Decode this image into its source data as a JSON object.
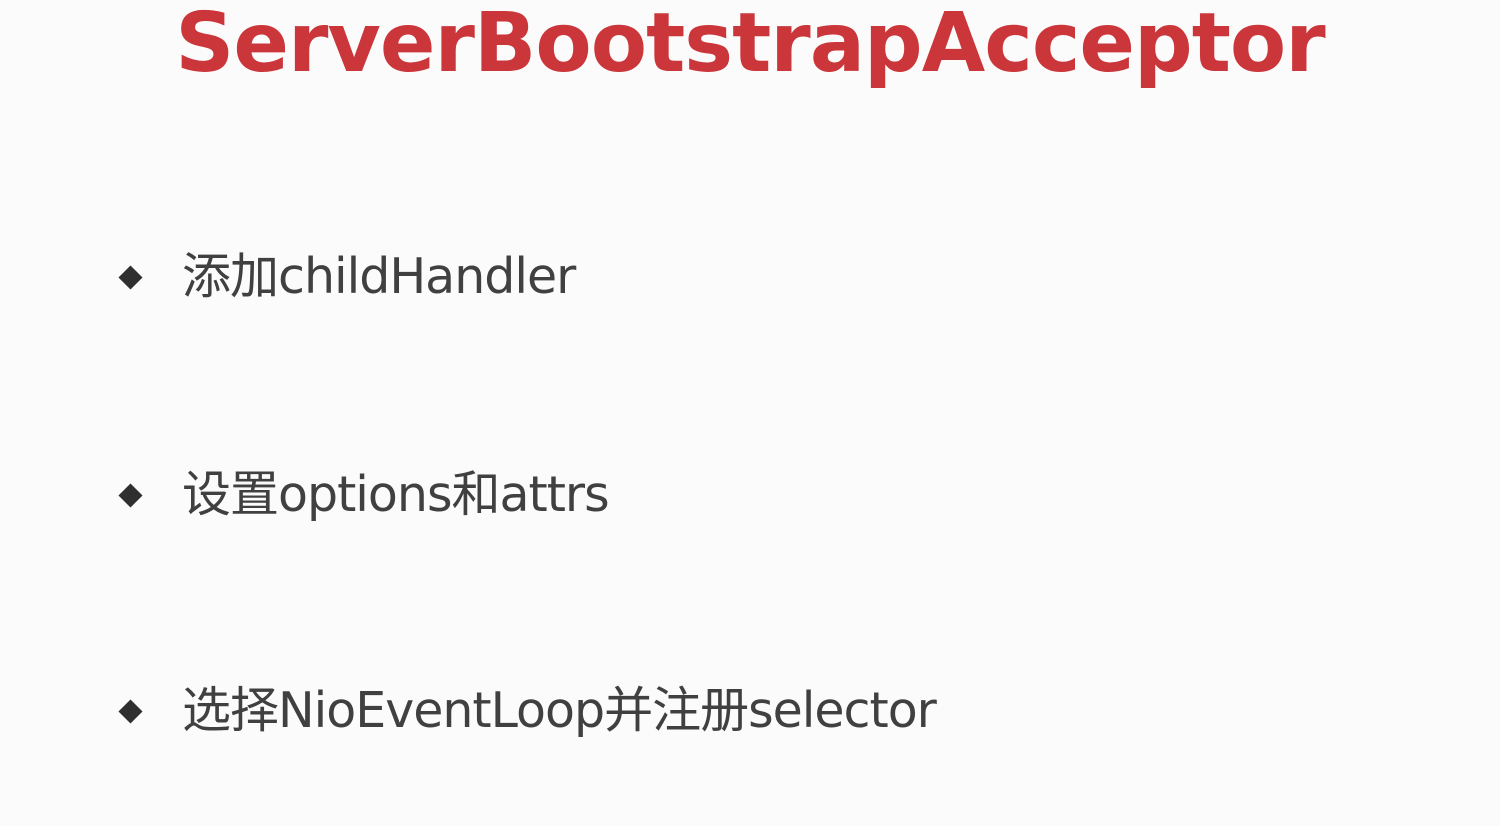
{
  "slide": {
    "title": "ServerBootstrapAcceptor",
    "bullets": [
      {
        "text": "添加childHandler",
        "icon": "diamond-bullet-icon"
      },
      {
        "text": "设置options和attrs",
        "icon": "diamond-bullet-icon"
      },
      {
        "text": "选择NioEventLoop并注册selector",
        "icon": "diamond-bullet-icon"
      }
    ]
  },
  "colors": {
    "background": "#fcfbfc",
    "title": "#cb363a",
    "body_text": "#404040",
    "bullet": "#2f2f2f"
  }
}
